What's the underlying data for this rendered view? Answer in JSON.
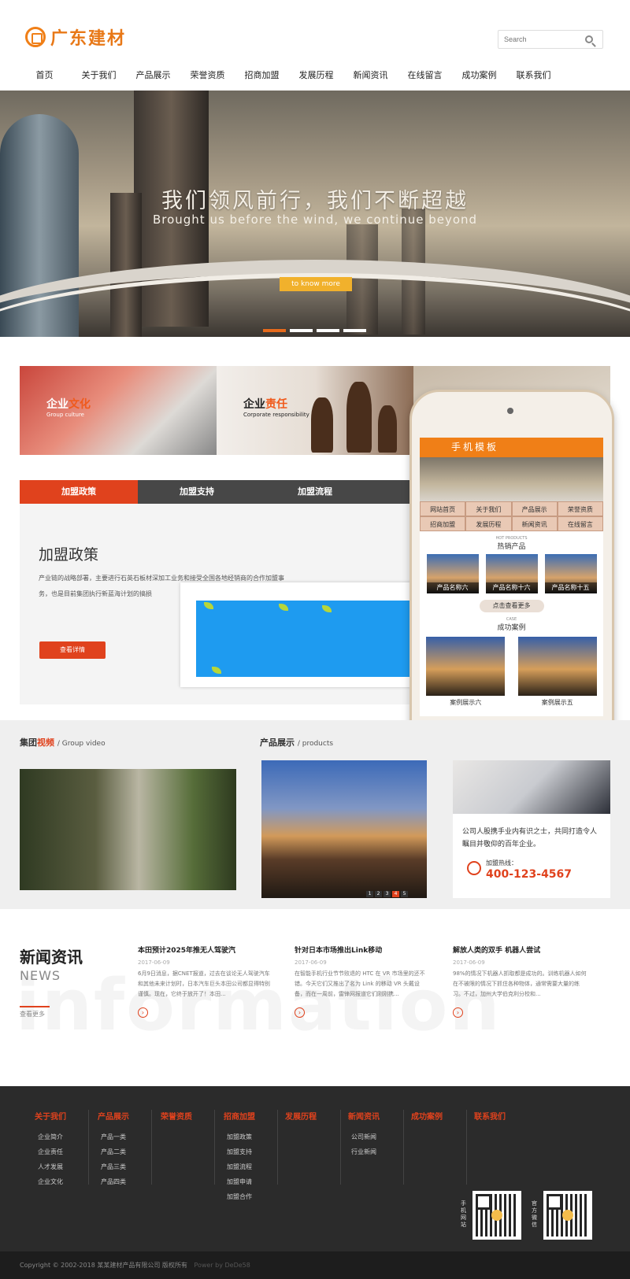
{
  "header": {
    "logo_text": "广东建材",
    "search_placeholder": "Search"
  },
  "nav": [
    "首页",
    "关于我们",
    "产品展示",
    "荣誉资质",
    "招商加盟",
    "发展历程",
    "新闻资讯",
    "在线留言",
    "成功案例",
    "联系我们"
  ],
  "banner": {
    "title": "我们领风前行，我们不断超越",
    "subtitle": "Brought us before the wind, we continue beyond",
    "button": "to know more"
  },
  "cards": [
    {
      "title_a": "企业",
      "title_b": "文化",
      "sub": "Group culture"
    },
    {
      "title_a": "企业",
      "title_b": "责任",
      "sub": "Corporate responsibility"
    }
  ],
  "tabs": [
    "加盟政策",
    "加盟支持",
    "加盟流程"
  ],
  "tab_content": {
    "title": "加盟政策",
    "text": "产业链的战略部署，主要进行石英石板材深加工业务和接受全国各地经销商的合作加盟事务，也是目前集团执行新蓝海计划的搞损",
    "button": "查看详情"
  },
  "phone": {
    "title": "手机模板",
    "menu": [
      "网站首页",
      "关于我们",
      "产品展示",
      "荣誉资质",
      "招商加盟",
      "发展历程",
      "新闻资讯",
      "在线留言"
    ],
    "hot_en": "HOT PRODUCTS",
    "hot": "热销产品",
    "products": [
      "产品名称六",
      "产品名称十六",
      "产品名称十五"
    ],
    "more": "点击查看更多",
    "case_en": "CASE",
    "case": "成功案例",
    "cases": [
      "案例展示六",
      "案例展示五"
    ]
  },
  "video": {
    "head_a": "集团",
    "head_b": "视频",
    "head_en": "/ Group video"
  },
  "products": {
    "head": "产品展示",
    "head_en": "/ products",
    "pages": [
      "1",
      "2",
      "3",
      "4",
      "5"
    ]
  },
  "join": {
    "text": "公司人股携手业内有识之士，共同打造令人瞩目并敬仰的百年企业。",
    "label": "加盟热线：",
    "phone": "400-123-4567"
  },
  "news": {
    "title": "新闻资讯",
    "title_en": "NEWS",
    "more": "查看更多",
    "bg_word": "information",
    "items": [
      {
        "title": "本田预计2025年推无人驾驶汽",
        "date": "2017-06-09",
        "text": "6月9日消息，据CNET报道，过去在谈论无人驾驶汽车和其他未来计划时，日本汽车巨头本田公司都显得特别谨慎。现在，它终于放开了！本田..."
      },
      {
        "title": "针对日本市场推出Link移动",
        "date": "2017-06-09",
        "text": "在智能手机行业节节败退的 HTC 在 VR 市场里的还不错。今天它们又推出了名为 Link 的移动 VR 头戴设备，而在一周前，雷锋网报道它们刚刚携..."
      },
      {
        "title": "解放人类的双手 机器人尝试",
        "date": "2017-06-09",
        "text": "98%的情况下机器人抓取都是成功的。训练机器人如何在不被限的情况下抓住各种物体，通常需要大量的练习。不过，加州大学伯克利分校和..."
      }
    ]
  },
  "footer": {
    "columns": [
      {
        "head": "关于我们",
        "items": [
          "企业简介",
          "企业责任",
          "人才发展",
          "企业文化"
        ]
      },
      {
        "head": "产品展示",
        "items": [
          "产品一类",
          "产品二类",
          "产品三类",
          "产品四类"
        ]
      },
      {
        "head": "荣誉资质",
        "items": []
      },
      {
        "head": "招商加盟",
        "items": [
          "加盟政策",
          "加盟支持",
          "加盟流程",
          "加盟申请",
          "加盟合作"
        ]
      },
      {
        "head": "发展历程",
        "items": []
      },
      {
        "head": "新闻资讯",
        "items": [
          "公司新闻",
          "行业新闻"
        ]
      },
      {
        "head": "成功案例",
        "items": []
      },
      {
        "head": "联系我们",
        "items": []
      }
    ],
    "qr_mobile": "手机网站",
    "qr_official": "官方微信",
    "copyright": "Copyright © 2002-2018 某某建材产品有限公司 版权所有",
    "powered": "Power by DeDe58"
  },
  "colors": {
    "accent": "#e0421d",
    "brand": "#f07f17"
  }
}
